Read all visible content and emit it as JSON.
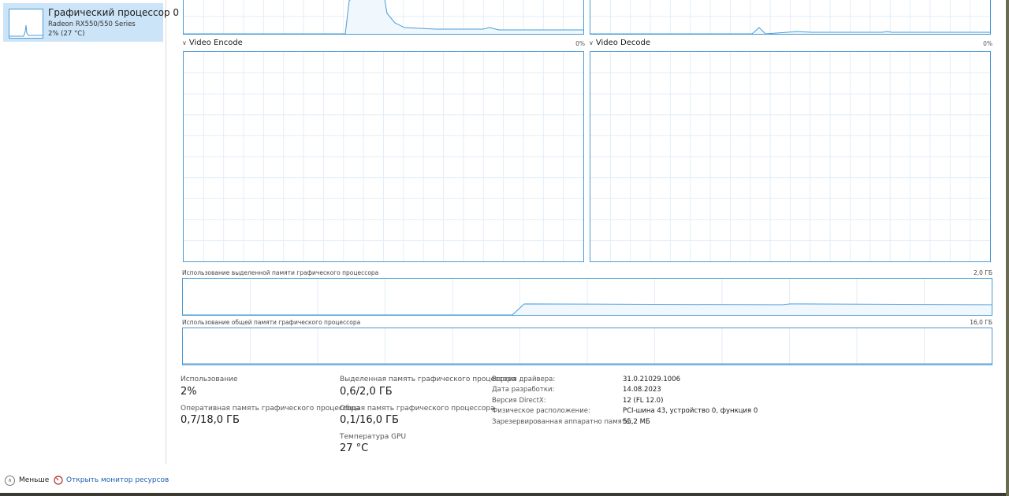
{
  "sidebar": {
    "gpu": {
      "title": "Графический процессор 0",
      "model": "Radeon RX550/550 Series",
      "usage": "2%  (27 °C)"
    }
  },
  "graphs": {
    "video_encode": {
      "title": "Video Encode",
      "percent": "0%"
    },
    "video_decode": {
      "title": "Video Decode",
      "percent": "0%"
    },
    "dedicated_memory": {
      "label": "Использование выделенной памяти графического процессора",
      "max": "2,0 ГБ"
    },
    "shared_memory": {
      "label": "Использование общей памяти графического процессора",
      "max": "16,0 ГБ"
    }
  },
  "stats": {
    "usage": {
      "label": "Использование",
      "value": "2%"
    },
    "gpu_ram": {
      "label": "Оперативная память графического процессора",
      "value": "0,7/18,0 ГБ"
    },
    "dedicated": {
      "label": "Выделенная память графического процессора",
      "value": "0,6/2,0 ГБ"
    },
    "shared": {
      "label": "Общая память графического процессора",
      "value": "0,1/16,0 ГБ"
    },
    "temperature": {
      "label": "Температура GPU",
      "value": "27 °C"
    }
  },
  "properties": [
    {
      "label": "Версия драйвера:",
      "value": "31.0.21029.1006"
    },
    {
      "label": "Дата разработки:",
      "value": "14.08.2023"
    },
    {
      "label": "Версия DirectX:",
      "value": "12 (FL 12.0)"
    },
    {
      "label": "Физическое расположение:",
      "value": "PCI-шина 43, устройство 0, функция 0"
    },
    {
      "label": "Зарезервированная аппаратно память:",
      "value": "55,2 МБ"
    }
  ],
  "footer": {
    "less_label": "Меньше",
    "monitor_label": "Открыть монитор ресурсов"
  },
  "colors": {
    "graph_border": "#4a9bd6",
    "grid": "#e3eef8",
    "fill": "#f0f7fd",
    "line": "#4a9bd6"
  }
}
